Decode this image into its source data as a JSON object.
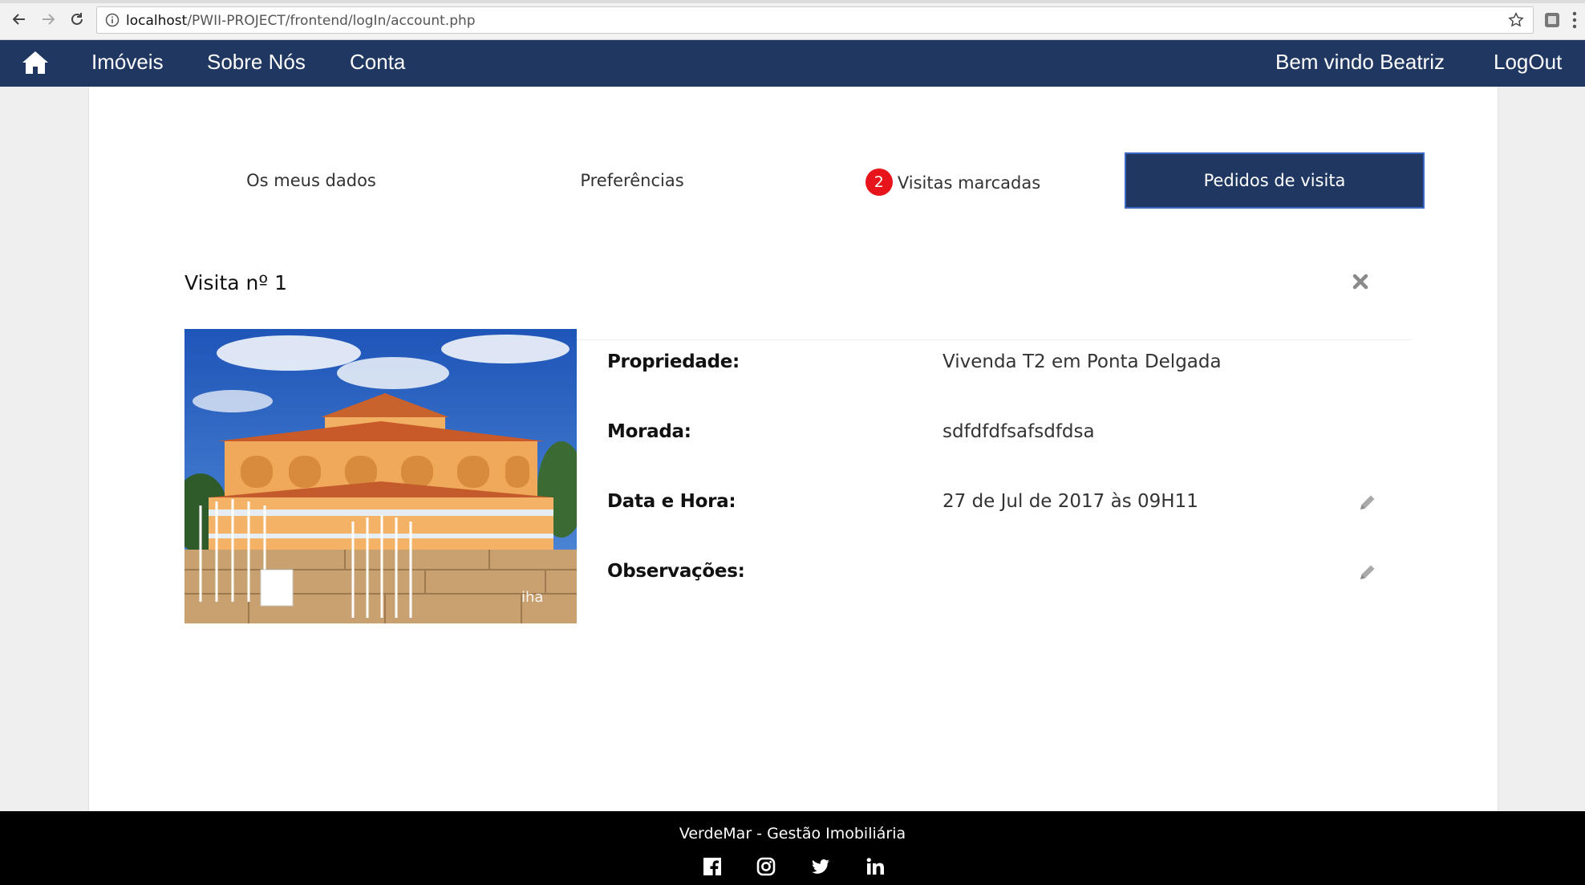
{
  "browser": {
    "url_host": "localhost",
    "url_path": "/PWII-PROJECT/frontend/logIn/account.php"
  },
  "nav": {
    "home_icon": "home-icon",
    "links": [
      "Imóveis",
      "Sobre Nós",
      "Conta"
    ],
    "welcome": "Bem vindo Beatriz",
    "logout": "LogOut"
  },
  "tabs": {
    "my_data": "Os meus dados",
    "preferences": "Preferências",
    "scheduled": "Visitas marcadas",
    "scheduled_count": "2",
    "requests": "Pedidos de visita"
  },
  "visit": {
    "title": "Visita nº 1",
    "fields": [
      {
        "label": "Propriedade:",
        "value": "Vivenda T2 em Ponta Delgada"
      },
      {
        "label": "Morada:",
        "value": "sdfdfdfsafsdfdsa"
      },
      {
        "label": "Data e Hora:",
        "value": "27 de Jul de 2017 às 09H11"
      },
      {
        "label": "Observações:",
        "value": ""
      }
    ]
  },
  "footer": {
    "brand": "VerdeMar - Gestão Imobiliária",
    "social_icons": [
      "facebook-icon",
      "instagram-icon",
      "twitter-icon",
      "linkedin-icon"
    ]
  },
  "colors": {
    "nav_bg": "#1f3761",
    "active_tab_bg": "#1f3761",
    "badge": "#e8141c",
    "footer_bg": "#000000"
  }
}
